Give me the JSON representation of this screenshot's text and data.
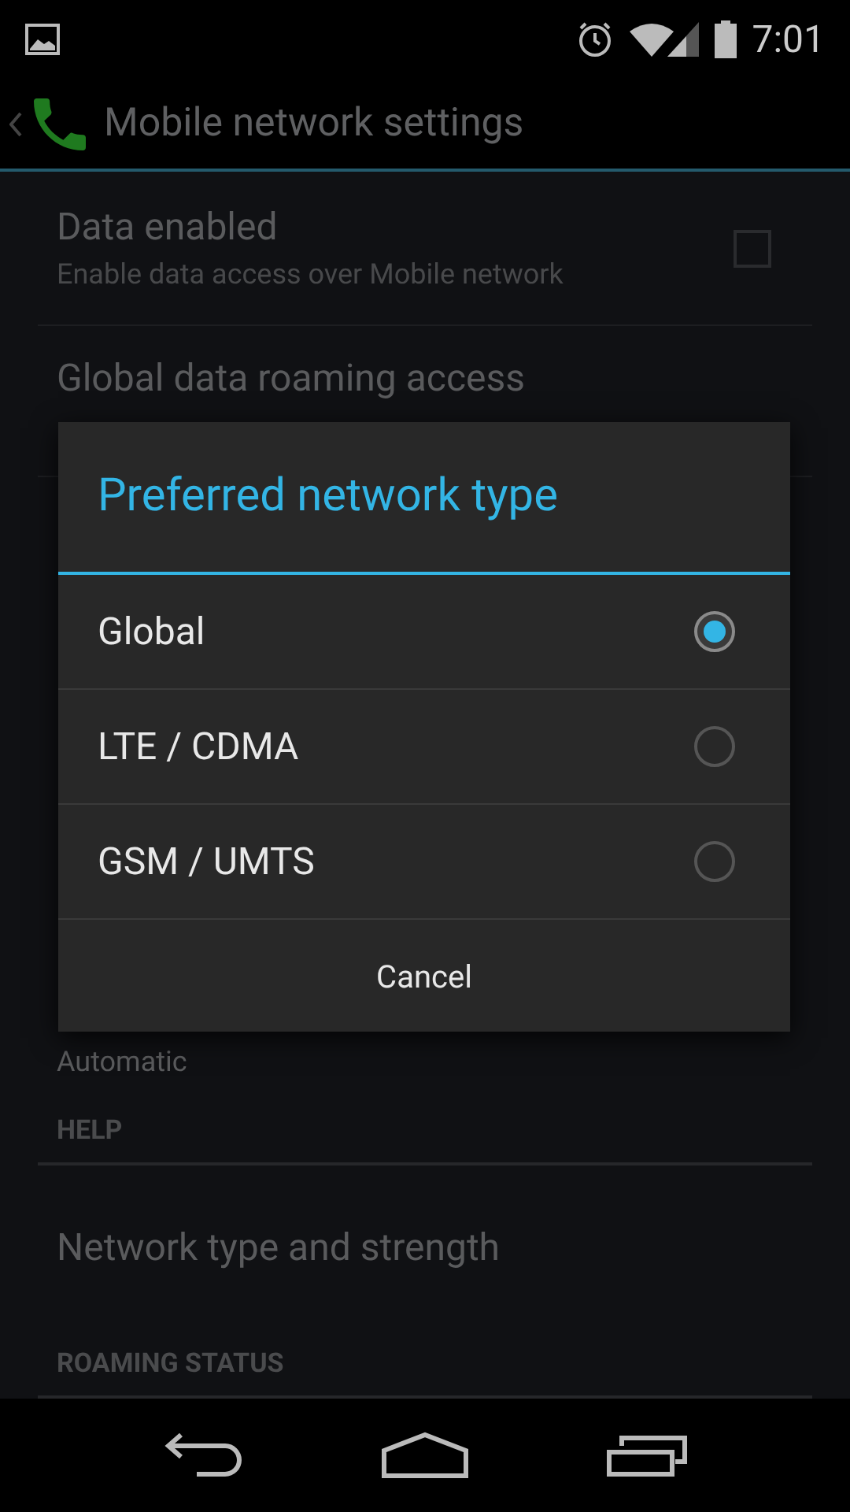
{
  "status_bar": {
    "time": "7:01"
  },
  "action_bar": {
    "title": "Mobile network settings"
  },
  "settings": [
    {
      "kind": "checkbox",
      "title": "Data enabled",
      "summary": "Enable data access over Mobile network",
      "checked": false
    },
    {
      "kind": "item",
      "title": "Global data roaming access"
    },
    {
      "kind": "summary",
      "summary": "Automatic"
    },
    {
      "kind": "header",
      "title": "HELP"
    },
    {
      "kind": "item",
      "title": "Network type and strength"
    },
    {
      "kind": "header",
      "title": "ROAMING STATUS"
    }
  ],
  "dialog": {
    "title": "Preferred network type",
    "options": [
      {
        "label": "Global",
        "selected": true
      },
      {
        "label": "LTE / CDMA",
        "selected": false
      },
      {
        "label": "GSM / UMTS",
        "selected": false
      }
    ],
    "button": "Cancel"
  }
}
